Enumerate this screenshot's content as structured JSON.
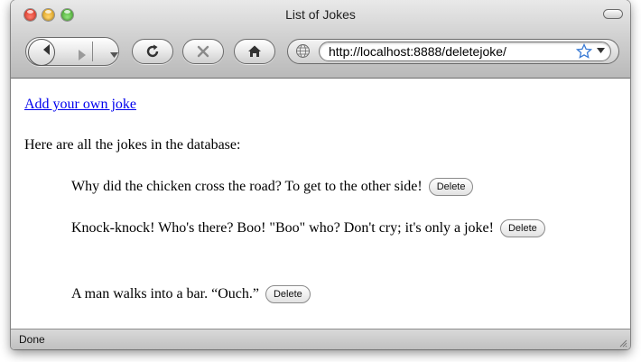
{
  "window": {
    "title": "List of Jokes"
  },
  "toolbar": {
    "url": "http://localhost:8888/deletejoke/",
    "back_icon": "back-arrow-icon",
    "forward_icon": "forward-arrow-icon",
    "reload_icon": "reload-icon",
    "stop_icon": "stop-icon",
    "home_icon": "home-icon",
    "site_icon": "globe-icon",
    "bookmark_icon": "star-icon"
  },
  "page": {
    "add_link": "Add your own joke",
    "intro": "Here are all the jokes in the database:",
    "delete_label": "Delete",
    "jokes": [
      {
        "text": "Why did the chicken cross the road? To get to the other side!"
      },
      {
        "text": "Knock-knock! Who's there? Boo! \"Boo\" who? Don't cry; it's only a joke!"
      },
      {
        "text": "A man walks into a bar. “Ouch.”"
      }
    ]
  },
  "status": {
    "text": "Done"
  },
  "colors": {
    "link": "#0000ee",
    "star": "#3a7bd5"
  }
}
